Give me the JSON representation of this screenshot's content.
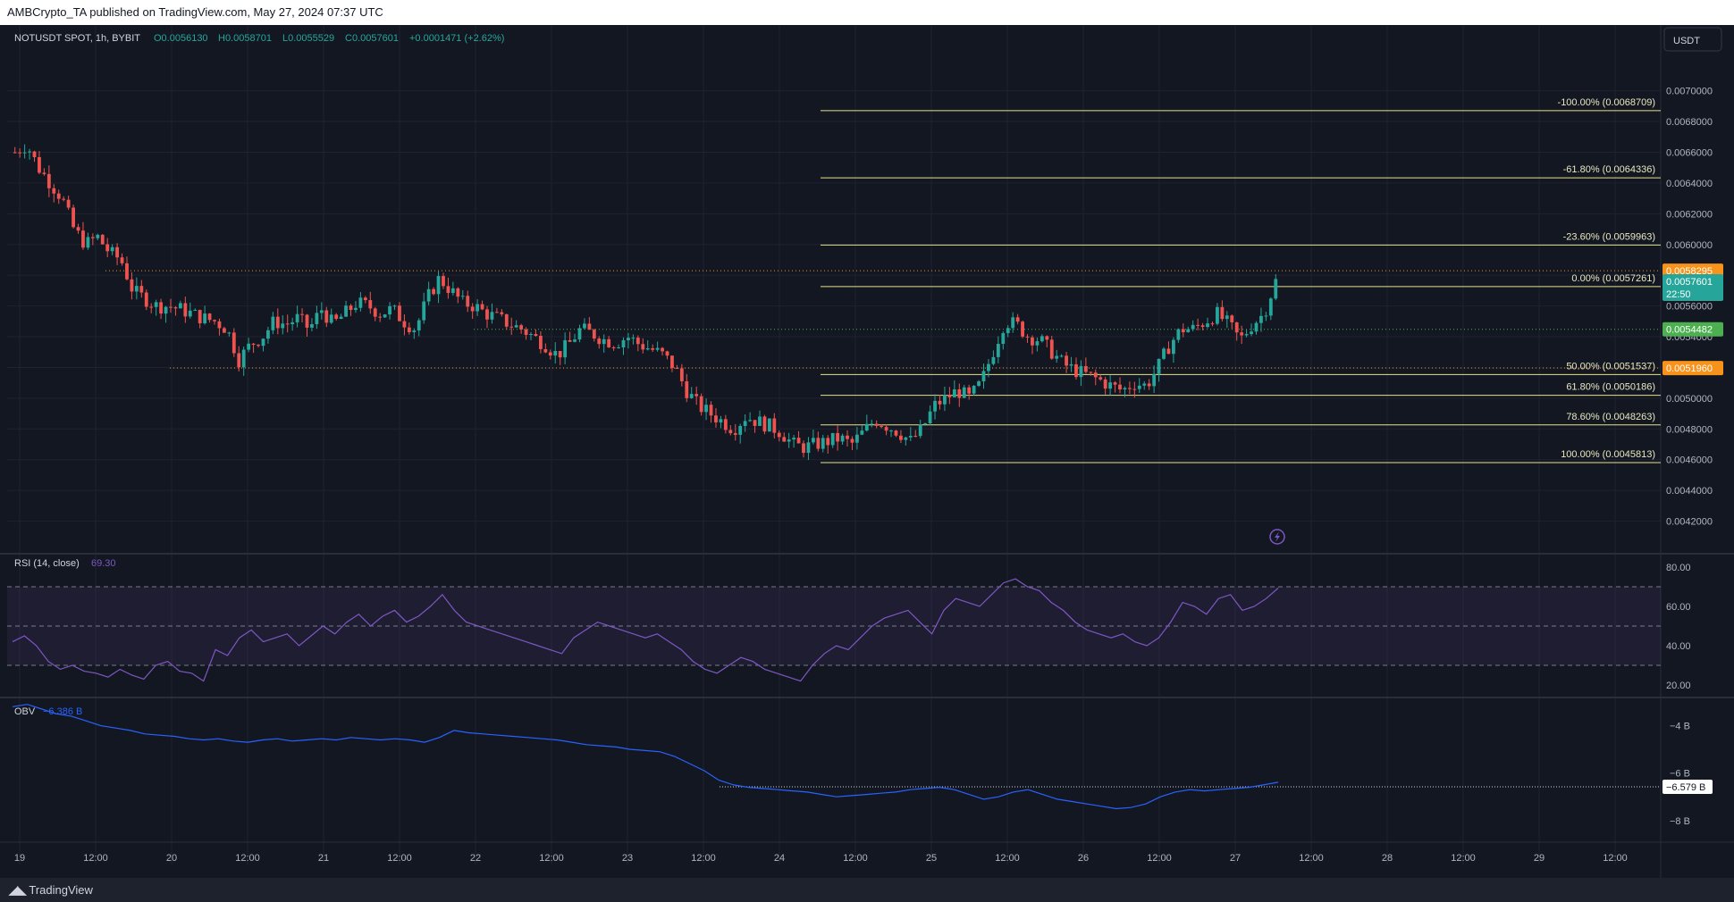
{
  "header": {
    "published": "AMBCrypto_TA published on TradingView.com, May 27, 2024 07:37 UTC"
  },
  "footer": {
    "brand": "TradingView"
  },
  "symbol": {
    "title": "NOTUSDT SPOT, 1h, BYBIT",
    "o": "O0.0056130",
    "h": "H0.0058701",
    "l": "L0.0055529",
    "c": "C0.0057601",
    "change": "+0.0001471 (+2.62%)"
  },
  "currency_button": "USDT",
  "colors": {
    "up": "#26a69a",
    "down": "#ef5350",
    "fib": "#e6e38a",
    "rsi": "#7e57c2",
    "obv": "#2962ff",
    "orange": "#f7931a",
    "green_label": "#4caf50"
  },
  "chart_data": [
    {
      "type": "candlestick",
      "title": "NOTUSDT SPOT, 1h, BYBIT",
      "ylim": [
        0.004,
        0.0073
      ],
      "y_ticks": [
        "0.0070000",
        "0.0068000",
        "0.0066000",
        "0.0064000",
        "0.0062000",
        "0.0060000",
        "0.0058000",
        "0.0056000",
        "0.0054000",
        "0.0052000",
        "0.0050000",
        "0.0048000",
        "0.0046000",
        "0.0044000",
        "0.0042000"
      ],
      "x_ticks": [
        "19",
        "12:00",
        "20",
        "12:00",
        "21",
        "12:00",
        "22",
        "12:00",
        "23",
        "12:00",
        "24",
        "12:00",
        "25",
        "12:00",
        "26",
        "12:00",
        "27",
        "12:00",
        "28",
        "12:00",
        "29",
        "12:00"
      ],
      "close_path": [
        0.0066,
        0.00665,
        0.0065,
        0.0064,
        0.0063,
        0.0061,
        0.006,
        0.00605,
        0.00595,
        0.0059,
        0.0057,
        0.00565,
        0.0056,
        0.0056,
        0.00558,
        0.00555,
        0.00552,
        0.0055,
        0.00545,
        0.00525,
        0.00535,
        0.0054,
        0.0055,
        0.00548,
        0.00552,
        0.00545,
        0.00558,
        0.00548,
        0.00555,
        0.00562,
        0.0056,
        0.00555,
        0.00558,
        0.0055,
        0.00545,
        0.00565,
        0.00578,
        0.0057,
        0.00562,
        0.0056,
        0.00555,
        0.00552,
        0.00548,
        0.00545,
        0.0054,
        0.00535,
        0.00528,
        0.00535,
        0.00545,
        0.00542,
        0.00538,
        0.00536,
        0.0054,
        0.00535,
        0.00532,
        0.00528,
        0.0052,
        0.00505,
        0.00495,
        0.0049,
        0.00485,
        0.0048,
        0.00488,
        0.00485,
        0.00482,
        0.00478,
        0.0047,
        0.00468,
        0.0047,
        0.00472,
        0.00474,
        0.0047,
        0.00478,
        0.00486,
        0.00482,
        0.00478,
        0.00472,
        0.0048,
        0.00495,
        0.005,
        0.00505,
        0.005,
        0.0051,
        0.0053,
        0.0055,
        0.00548,
        0.0054,
        0.00538,
        0.0053,
        0.00522,
        0.00518,
        0.00515,
        0.00512,
        0.00508,
        0.00505,
        0.0051,
        0.00508,
        0.0052,
        0.00535,
        0.00545,
        0.00545,
        0.0055,
        0.00555,
        0.00548,
        0.00538,
        0.00548,
        0.00555,
        0.00576
      ],
      "fib_levels": [
        {
          "label": "-100.00% (0.0068709)",
          "value": 0.0068709
        },
        {
          "label": "-61.80% (0.0064336)",
          "value": 0.0064336
        },
        {
          "label": "-23.60% (0.0059963)",
          "value": 0.0059963
        },
        {
          "label": "0.00% (0.0057261)",
          "value": 0.0057261
        },
        {
          "label": "50.00% (0.0051537)",
          "value": 0.0051537
        },
        {
          "label": "61.80% (0.0050186)",
          "value": 0.0050186
        },
        {
          "label": "78.60% (0.0048263)",
          "value": 0.0048263
        },
        {
          "label": "100.00% (0.0045813)",
          "value": 0.0045813
        }
      ],
      "horizontal_levels": [
        {
          "value": 0.0058295,
          "style": "orange-dotted"
        },
        {
          "value": 0.0054482,
          "style": "green-dotted"
        },
        {
          "value": 0.005196,
          "style": "orange-dotted"
        }
      ],
      "price_labels": [
        {
          "text": "0.0058295",
          "value": 0.0058295,
          "color": "#f7931a"
        },
        {
          "text": "0.0057601",
          "sub": "22:50",
          "value": 0.0057601,
          "color": "#26a69a"
        },
        {
          "text": "0.0054482",
          "value": 0.0054482,
          "color": "#4caf50"
        },
        {
          "text": "0.0051960",
          "value": 0.005196,
          "color": "#f7931a"
        }
      ]
    },
    {
      "type": "line",
      "title": "RSI (14, close)",
      "last_value": "69.30",
      "ylim": [
        15,
        85
      ],
      "y_ticks": [
        "80.00",
        "60.00",
        "40.00",
        "20.00"
      ],
      "bands": [
        70,
        50,
        30
      ],
      "values": [
        42,
        45,
        40,
        32,
        28,
        30,
        27,
        26,
        24,
        28,
        25,
        23,
        30,
        32,
        27,
        26,
        22,
        38,
        35,
        44,
        48,
        42,
        44,
        46,
        40,
        45,
        50,
        46,
        52,
        56,
        50,
        55,
        58,
        52,
        55,
        60,
        66,
        58,
        52,
        50,
        48,
        46,
        44,
        42,
        40,
        38,
        36,
        44,
        48,
        52,
        50,
        48,
        46,
        44,
        46,
        42,
        38,
        32,
        28,
        26,
        30,
        34,
        32,
        28,
        26,
        24,
        22,
        30,
        36,
        40,
        38,
        44,
        50,
        54,
        56,
        58,
        52,
        46,
        58,
        64,
        62,
        60,
        66,
        72,
        74,
        70,
        68,
        62,
        58,
        52,
        48,
        46,
        44,
        46,
        42,
        40,
        44,
        52,
        62,
        60,
        56,
        64,
        66,
        58,
        60,
        64,
        69.3
      ]
    },
    {
      "type": "line",
      "title": "OBV",
      "last_value": "−6.386 B",
      "ylim": [
        -8.8,
        -3.0
      ],
      "y_ticks": [
        "−4 B",
        "−6 B",
        "−8 B"
      ],
      "reference_line": {
        "value": -6.579,
        "label": "−6.579 B"
      },
      "values": [
        -3.2,
        -3.1,
        -3.3,
        -3.5,
        -3.6,
        -3.8,
        -4.0,
        -4.1,
        -4.2,
        -4.35,
        -4.4,
        -4.45,
        -4.55,
        -4.6,
        -4.55,
        -4.65,
        -4.7,
        -4.6,
        -4.55,
        -4.65,
        -4.6,
        -4.55,
        -4.6,
        -4.5,
        -4.55,
        -4.6,
        -4.55,
        -4.6,
        -4.7,
        -4.5,
        -4.2,
        -4.3,
        -4.35,
        -4.4,
        -4.45,
        -4.5,
        -4.55,
        -4.6,
        -4.7,
        -4.8,
        -4.85,
        -4.9,
        -5.0,
        -5.05,
        -5.1,
        -5.3,
        -5.6,
        -5.9,
        -6.3,
        -6.5,
        -6.6,
        -6.65,
        -6.7,
        -6.75,
        -6.8,
        -6.9,
        -7.0,
        -6.95,
        -6.9,
        -6.85,
        -6.8,
        -6.7,
        -6.65,
        -6.6,
        -6.7,
        -6.9,
        -7.1,
        -7.0,
        -6.8,
        -6.7,
        -6.9,
        -7.1,
        -7.2,
        -7.3,
        -7.4,
        -7.5,
        -7.45,
        -7.3,
        -7.0,
        -6.8,
        -6.7,
        -6.75,
        -6.7,
        -6.65,
        -6.6,
        -6.5,
        -6.386
      ]
    }
  ],
  "overlay": {
    "alert_icon": "lightning-icon"
  }
}
